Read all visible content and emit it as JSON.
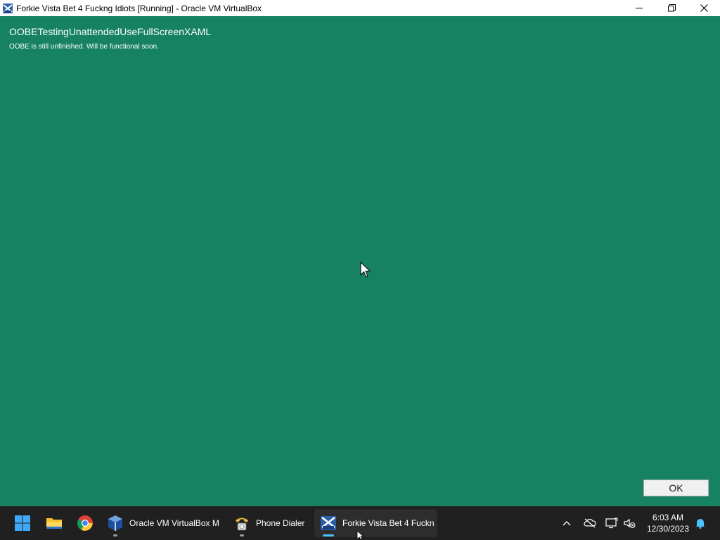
{
  "window": {
    "title": "Forkie Vista Bet 4 Fuckng Idiots [Running] - Oracle VM VirtualBox",
    "minimize_icon": "minimize-icon",
    "restore_icon": "restore-icon",
    "close_icon": "close-icon"
  },
  "vm": {
    "background": "#168262",
    "title": "OOBETestingUnattendedUseFullScreenXAML",
    "message": "OOBE is still unfinished. Will be functional soon.",
    "ok_label": "OK"
  },
  "taskbar": {
    "start_icon": "windows-start-icon",
    "pinned": [
      {
        "icon": "file-explorer-icon"
      },
      {
        "icon": "chrome-icon"
      }
    ],
    "apps": [
      {
        "icon": "virtualbox-icon",
        "label": "Oracle VM VirtualBox M"
      },
      {
        "icon": "phone-dialer-icon",
        "label": "Phone Dialer"
      },
      {
        "icon": "vista-vm-icon",
        "label": "Forkie Vista Bet 4 Fuckn",
        "active": true
      }
    ],
    "tray": {
      "chevron_icon": "chevron-up-icon",
      "icons": [
        "network-off-icon",
        "display-icon",
        "volume-muted-icon"
      ],
      "time": "6:03 AM",
      "date": "12/30/2023",
      "notification_icon": "bell-icon"
    }
  }
}
